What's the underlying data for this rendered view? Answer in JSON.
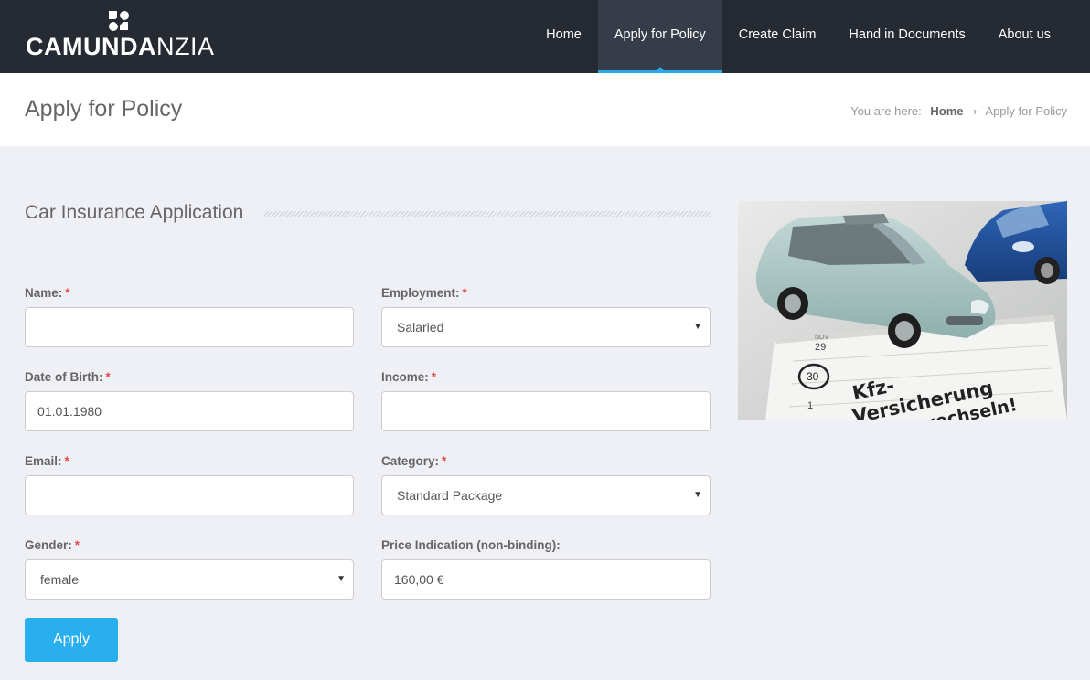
{
  "brand": {
    "name_bold": "CAMUNDA",
    "name_light": "NZIA"
  },
  "nav": {
    "items": [
      {
        "label": "Home"
      },
      {
        "label": "Apply for Policy"
      },
      {
        "label": "Create Claim"
      },
      {
        "label": "Hand in Documents"
      },
      {
        "label": "About us"
      }
    ],
    "active_index": 1
  },
  "page": {
    "title": "Apply for Policy",
    "breadcrumb": {
      "prefix": "You are here:",
      "home": "Home",
      "separator": "›",
      "current": "Apply for Policy"
    }
  },
  "form": {
    "title": "Car Insurance Application",
    "required_marker": "*",
    "name": {
      "label": "Name:",
      "value": ""
    },
    "dob": {
      "label": "Date of Birth:",
      "value": "01.01.1980"
    },
    "email": {
      "label": "Email:",
      "value": ""
    },
    "gender": {
      "label": "Gender:",
      "value": "female"
    },
    "employment": {
      "label": "Employment:",
      "value": "Salaried"
    },
    "income": {
      "label": "Income:",
      "value": ""
    },
    "category": {
      "label": "Category:",
      "value": "Standard Package"
    },
    "price": {
      "label": "Price Indication (non-binding):",
      "value": "160,00 €"
    },
    "submit_label": "Apply"
  },
  "image": {
    "calendar_numbers": [
      "NOV",
      "29",
      "30",
      "1"
    ],
    "handwriting_line1": "Kfz-",
    "handwriting_line2": "Versicherung",
    "handwriting_line3": "wechseln!"
  },
  "colors": {
    "navbar": "#262b33",
    "accent": "#29aff0",
    "required": "#e04b4b",
    "background": "#eff0f5"
  }
}
